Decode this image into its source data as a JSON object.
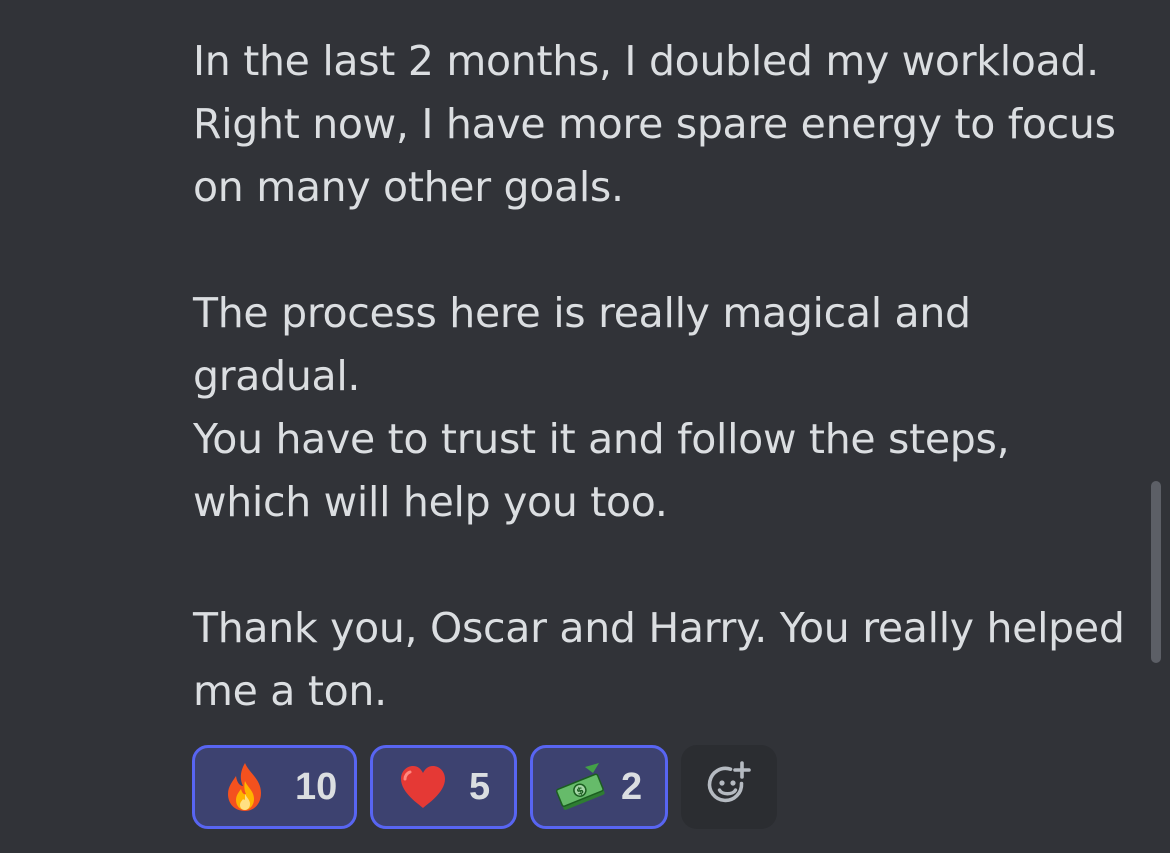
{
  "message": {
    "lines": [
      "In the last 2 months, I doubled my workload.",
      "Right now, I have more spare energy to focus",
      "on many other goals.",
      "The process here is really magical and",
      "gradual.",
      "You have to trust it and follow the steps,",
      "which will help you too.",
      "Thank you, Oscar and Harry. You really helped",
      "me a ton."
    ]
  },
  "reactions": [
    {
      "emoji": "fire-icon",
      "count": "10"
    },
    {
      "emoji": "heart-icon",
      "count": "5"
    },
    {
      "emoji": "money-with-wings-icon",
      "count": "2"
    }
  ],
  "add_reaction": {
    "icon": "add-reaction-icon"
  },
  "colors": {
    "background": "#313338",
    "text": "#dbdee1",
    "reaction_bg": "#3d4270",
    "reaction_border": "#5865f2",
    "add_reaction_bg": "#2b2d31"
  }
}
